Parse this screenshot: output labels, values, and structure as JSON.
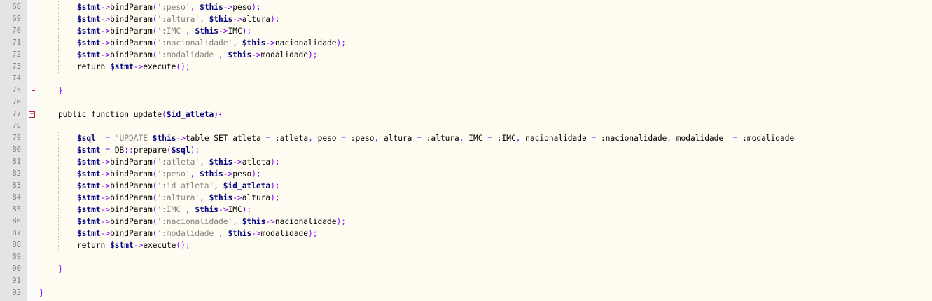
{
  "editor": {
    "gutter_lines": [
      "68",
      "69",
      "70",
      "71",
      "72",
      "73",
      "74",
      "75",
      "76",
      "77",
      "78",
      "79",
      "80",
      "81",
      "82",
      "83",
      "84",
      "85",
      "86",
      "87",
      "88",
      "89",
      "90",
      "91",
      "92"
    ],
    "code_lines": [
      "        $stmt->bindParam(':peso', $this->peso);",
      "        $stmt->bindParam(':altura', $this->altura);",
      "        $stmt->bindParam(':IMC', $this->IMC);",
      "        $stmt->bindParam(':nacionalidade', $this->nacionalidade);",
      "        $stmt->bindParam(':modalidade', $this->modalidade);",
      "        return $stmt->execute();",
      "",
      "    }",
      "",
      "    public function update($id_atleta){",
      "",
      "        $sql  = \"UPDATE $this->table SET atleta = :atleta, peso = :peso, altura = :altura, IMC = :IMC, nacionalidade = :nacionalidade, modalidade  = :modalidade",
      "        $stmt = DB::prepare($sql);",
      "        $stmt->bindParam(':atleta', $this->atleta);",
      "        $stmt->bindParam(':peso', $this->peso);",
      "        $stmt->bindParam(':id_atleta', $id_atleta);",
      "        $stmt->bindParam(':altura', $this->altura);",
      "        $stmt->bindParam(':IMC', $this->IMC);",
      "        $stmt->bindParam(':nacionalidade', $this->nacionalidade);",
      "        $stmt->bindParam(':modalidade', $this->modalidade);",
      "        return $stmt->execute();",
      "",
      "    }",
      "",
      "}"
    ],
    "fold_markers": [
      "minus-box"
    ],
    "colors": {
      "background": "#fefcf0",
      "gutter": "#e4e4e4",
      "line_numbers": "#808080",
      "fold_margin": "#c72222",
      "variable": "#000080",
      "operator": "#8000ff",
      "string": "#808080"
    }
  }
}
